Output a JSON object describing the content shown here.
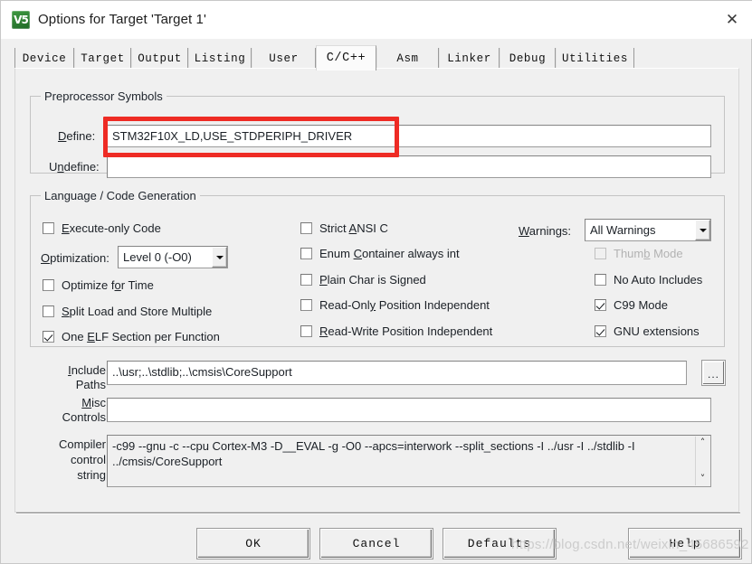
{
  "window": {
    "title": "Options for Target 'Target 1'",
    "icon": "keil-uvision-icon",
    "icon_glyph": "V5",
    "close_label": "✕"
  },
  "tabs": [
    {
      "label": "Device",
      "active": false
    },
    {
      "label": "Target",
      "active": false
    },
    {
      "label": "Output",
      "active": false
    },
    {
      "label": "Listing",
      "active": false
    },
    {
      "label": "User",
      "active": false
    },
    {
      "label": "C/C++",
      "active": true
    },
    {
      "label": "Asm",
      "active": false
    },
    {
      "label": "Linker",
      "active": false
    },
    {
      "label": "Debug",
      "active": false
    },
    {
      "label": "Utilities",
      "active": false
    }
  ],
  "preprocessor": {
    "legend": "Preprocessor Symbols",
    "define_label": "Define:",
    "define_value": "STM32F10X_LD,USE_STDPERIPH_DRIVER",
    "undefine_label": "Undefine:",
    "undefine_value": "",
    "highlight_color": "#ee2b24"
  },
  "language": {
    "legend": "Language / Code Generation",
    "left_column": [
      {
        "label": "Execute-only Code",
        "checked": false,
        "disabled": false
      },
      {
        "label": "Optimize for Time",
        "checked": false,
        "disabled": false
      },
      {
        "label": "Split Load and Store Multiple",
        "checked": false,
        "disabled": false
      },
      {
        "label": "One ELF Section per Function",
        "checked": true,
        "disabled": false
      }
    ],
    "optimization_label": "Optimization:",
    "optimization_value": "Level 0 (-O0)",
    "middle_column": [
      {
        "label": "Strict ANSI C",
        "checked": false,
        "disabled": false
      },
      {
        "label": "Enum Container always int",
        "checked": false,
        "disabled": false
      },
      {
        "label": "Plain Char is Signed",
        "checked": false,
        "disabled": false
      },
      {
        "label": "Read-Only Position Independent",
        "checked": false,
        "disabled": false
      },
      {
        "label": "Read-Write Position Independent",
        "checked": false,
        "disabled": false
      }
    ],
    "warnings_label": "Warnings:",
    "warnings_value": "All Warnings",
    "right_column": [
      {
        "label": "Thumb Mode",
        "checked": false,
        "disabled": true
      },
      {
        "label": "No Auto Includes",
        "checked": false,
        "disabled": false
      },
      {
        "label": "C99 Mode",
        "checked": true,
        "disabled": false
      },
      {
        "label": "GNU extensions",
        "checked": true,
        "disabled": false
      }
    ]
  },
  "paths": {
    "include_label_line1": "Include",
    "include_label_line2": "Paths",
    "include_value": "..\\usr;..\\stdlib;..\\cmsis\\CoreSupport",
    "browse_label": "...",
    "misc_label_line1": "Misc",
    "misc_label_line2": "Controls",
    "misc_value": "",
    "compiler_label_line1": "Compiler",
    "compiler_label_line2": "control",
    "compiler_label_line3": "string",
    "compiler_value": "-c99 --gnu -c --cpu Cortex-M3 -D__EVAL -g -O0 --apcs=interwork --split_sections -I ../usr -I ../stdlib -I ../cmsis/CoreSupport",
    "scroll_up": "˄",
    "scroll_down": "˅"
  },
  "footer": {
    "ok": "OK",
    "cancel": "Cancel",
    "defaults": "Defaults",
    "help": "Help"
  },
  "watermark": "https://blog.csdn.net/weixin_45686592"
}
